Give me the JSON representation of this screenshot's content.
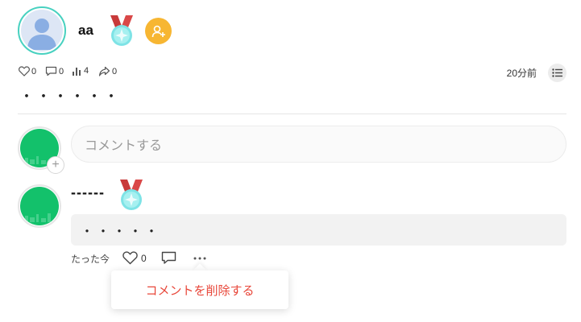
{
  "post": {
    "username": "aa",
    "body": "・・・・・・",
    "time": "20分前",
    "stats": {
      "likes": "0",
      "comments": "0",
      "views": "4",
      "shares": "0"
    }
  },
  "comment_box": {
    "placeholder": "コメントする"
  },
  "comment": {
    "author": "------",
    "body": "・・・・・",
    "time": "たった今",
    "likes": "0"
  },
  "popup": {
    "delete_label": "コメントを削除する"
  },
  "colors": {
    "accent_teal": "#48d1c0",
    "follow_orange": "#f7b632",
    "avatar_green": "#13c16b",
    "danger_red": "#e8473a"
  }
}
